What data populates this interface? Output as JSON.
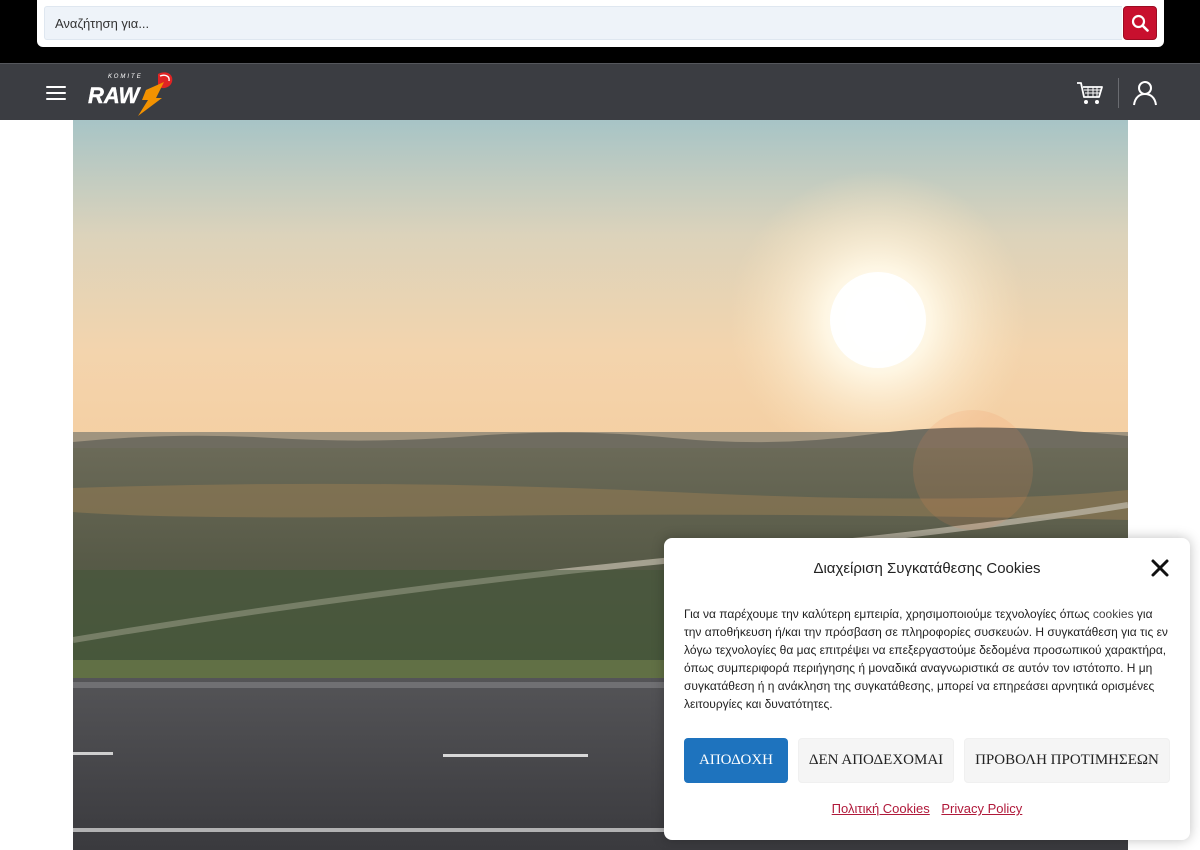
{
  "search": {
    "placeholder": "Αναζήτηση για..."
  },
  "header": {
    "logo_text": "RAW",
    "logo_subtext": "ΚΟΜΙΤΕ"
  },
  "cookie_modal": {
    "title": "Διαχείριση Συγκατάθεσης Cookies",
    "body_prefix": "Για να παρέχουμε την καλύτερη εμπειρία, χρησιμοποιούμε τεχνολογίες όπως ",
    "body_cookies_word": "cookies",
    "body_suffix": " για την αποθήκευση ή/και την πρόσβαση σε πληροφορίες συσκευών. Η συγκατάθεση για τις εν λόγω τεχνολογίες θα μας επιτρέψει να επεξεργαστούμε δεδομένα προσωπικού χαρακτήρα, όπως συμπεριφορά περιήγησης ή μοναδικά αναγνωριστικά σε αυτόν τον ιστότοπο. Η μη συγκατάθεση ή η ανάκληση της συγκατάθεσης, μπορεί να επηρεάσει αρνητικά ορισμένες λειτουργίες και δυνατότητες.",
    "accept_label": "ΑΠΟΔΟΧΗ",
    "deny_label": "ΔΕΝ ΑΠΟΔΕΧΟΜΑΙ",
    "prefs_label": "ΠΡΟΒΟΛΗ ΠΡΟΤΙΜΗΣΕΩΝ",
    "links": [
      "Πολιτική Cookies",
      "Privacy Policy"
    ]
  },
  "colors": {
    "top_strip": "#000000",
    "nav_bar": "#3b3d42",
    "search_button": "#c8102e",
    "accept_button": "#1e73be",
    "link": "#b0193a"
  }
}
